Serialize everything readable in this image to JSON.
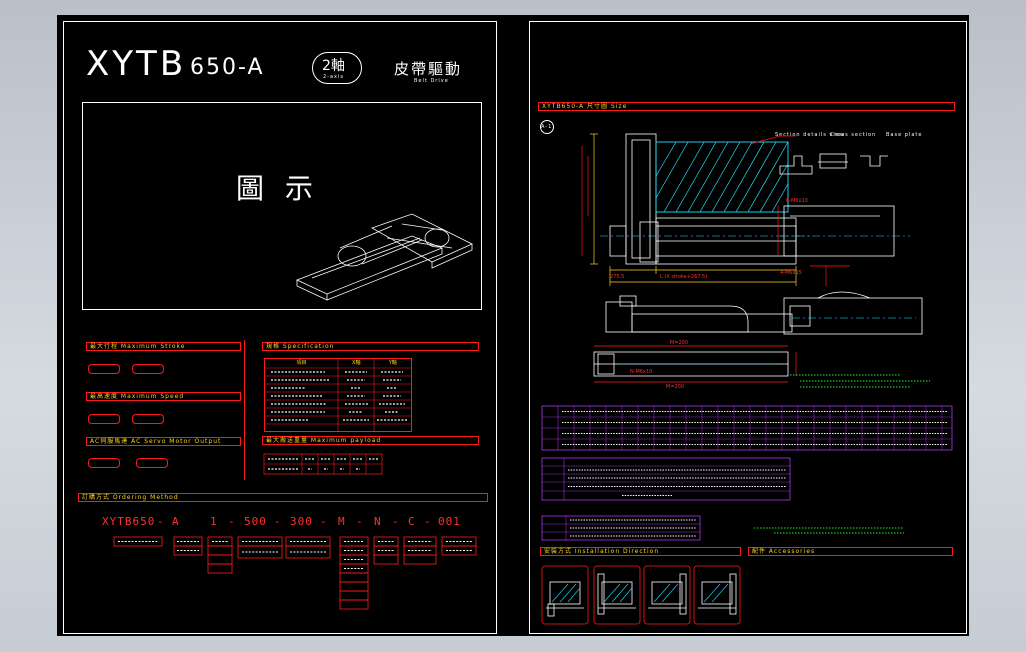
{
  "left_sheet": {
    "model": "XYTB",
    "model_suffix": "650-A",
    "axis_badge": "2軸",
    "axis_badge_sub": "2-axis",
    "drive_cn": "皮帶驅動",
    "drive_en": "Belt Drive",
    "illustration_label": "圖 示",
    "sections": {
      "max_stroke": "最大行程 Maximum Stroke",
      "max_speed": "最高速度 Maximum Speed",
      "motor": "AC伺服馬達 AC Servo Motor Output",
      "spec": "規格 Specification",
      "payload": "最大搬送重量 Maximum payload",
      "ordering": "訂購方式 Ordering Method"
    },
    "spec_headers": [
      "項目",
      "X軸",
      "Y軸"
    ],
    "ordering_code": [
      "XYTB650",
      "A",
      "1",
      "500",
      "300",
      "M",
      "N",
      "C",
      "001"
    ],
    "ordering_separators": [
      "-",
      "-",
      "-",
      "-",
      "-",
      "-",
      "-",
      "-"
    ]
  },
  "right_sheet": {
    "title": "XYTB650-A 尺寸圖 Size",
    "view_marker": "A-1",
    "notes_top": [
      "Section details view",
      "Cross section",
      "Base plate"
    ],
    "dim_labels": [
      "L (X stroke+267.5)",
      "M=200",
      "M=200",
      "275.5",
      "N-M6x10",
      "4-M6x15",
      "8-M6x10"
    ],
    "sections": {
      "installation": "安裝方式 Installation Direction",
      "accessories": "配件 Accessories"
    }
  },
  "colors": {
    "background": "#000000",
    "frame": "#ffffff",
    "red": "#ff1a1a",
    "yellow": "#ffd21c",
    "cyan": "#20e0ff",
    "green": "#22ee22",
    "purple": "#9a2fd0"
  }
}
